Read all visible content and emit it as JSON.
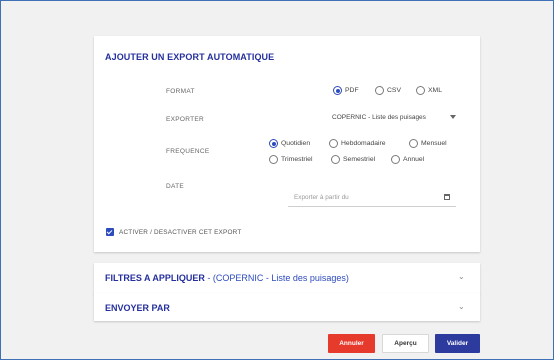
{
  "main": {
    "title": "AJOUTER UN EXPORT AUTOMATIQUE",
    "format": {
      "label": "FORMAT",
      "options": [
        {
          "label": "PDF",
          "selected": true
        },
        {
          "label": "CSV",
          "selected": false
        },
        {
          "label": "XML",
          "selected": false
        }
      ]
    },
    "exporter": {
      "label": "EXPORTER",
      "value": "COPERNIC - Liste des puisages"
    },
    "frequence": {
      "label": "FREQUENCE",
      "options": [
        {
          "label": "Quotidien",
          "selected": true
        },
        {
          "label": "Hebdomadaire",
          "selected": false
        },
        {
          "label": "Mensuel",
          "selected": false
        },
        {
          "label": "Trimestriel",
          "selected": false
        },
        {
          "label": "Semestriel",
          "selected": false
        },
        {
          "label": "Annuel",
          "selected": false
        }
      ]
    },
    "date": {
      "label": "DATE",
      "placeholder": "Exporter à partir du"
    },
    "activate": {
      "label": "ACTIVER / DESACTIVER CET EXPORT",
      "checked": true
    }
  },
  "filters": {
    "title": "FILTRES A APPLIQUER",
    "subtitle": " - (COPERNIC - Liste des puisages)"
  },
  "send": {
    "title": "ENVOYER PAR"
  },
  "buttons": {
    "cancel": "Annuler",
    "preview": "Aperçu",
    "validate": "Valider"
  },
  "colors": {
    "accent": "#2d4bbd",
    "title": "#25309d",
    "cancel": "#e53a2c",
    "validate": "#2d3a9e"
  }
}
